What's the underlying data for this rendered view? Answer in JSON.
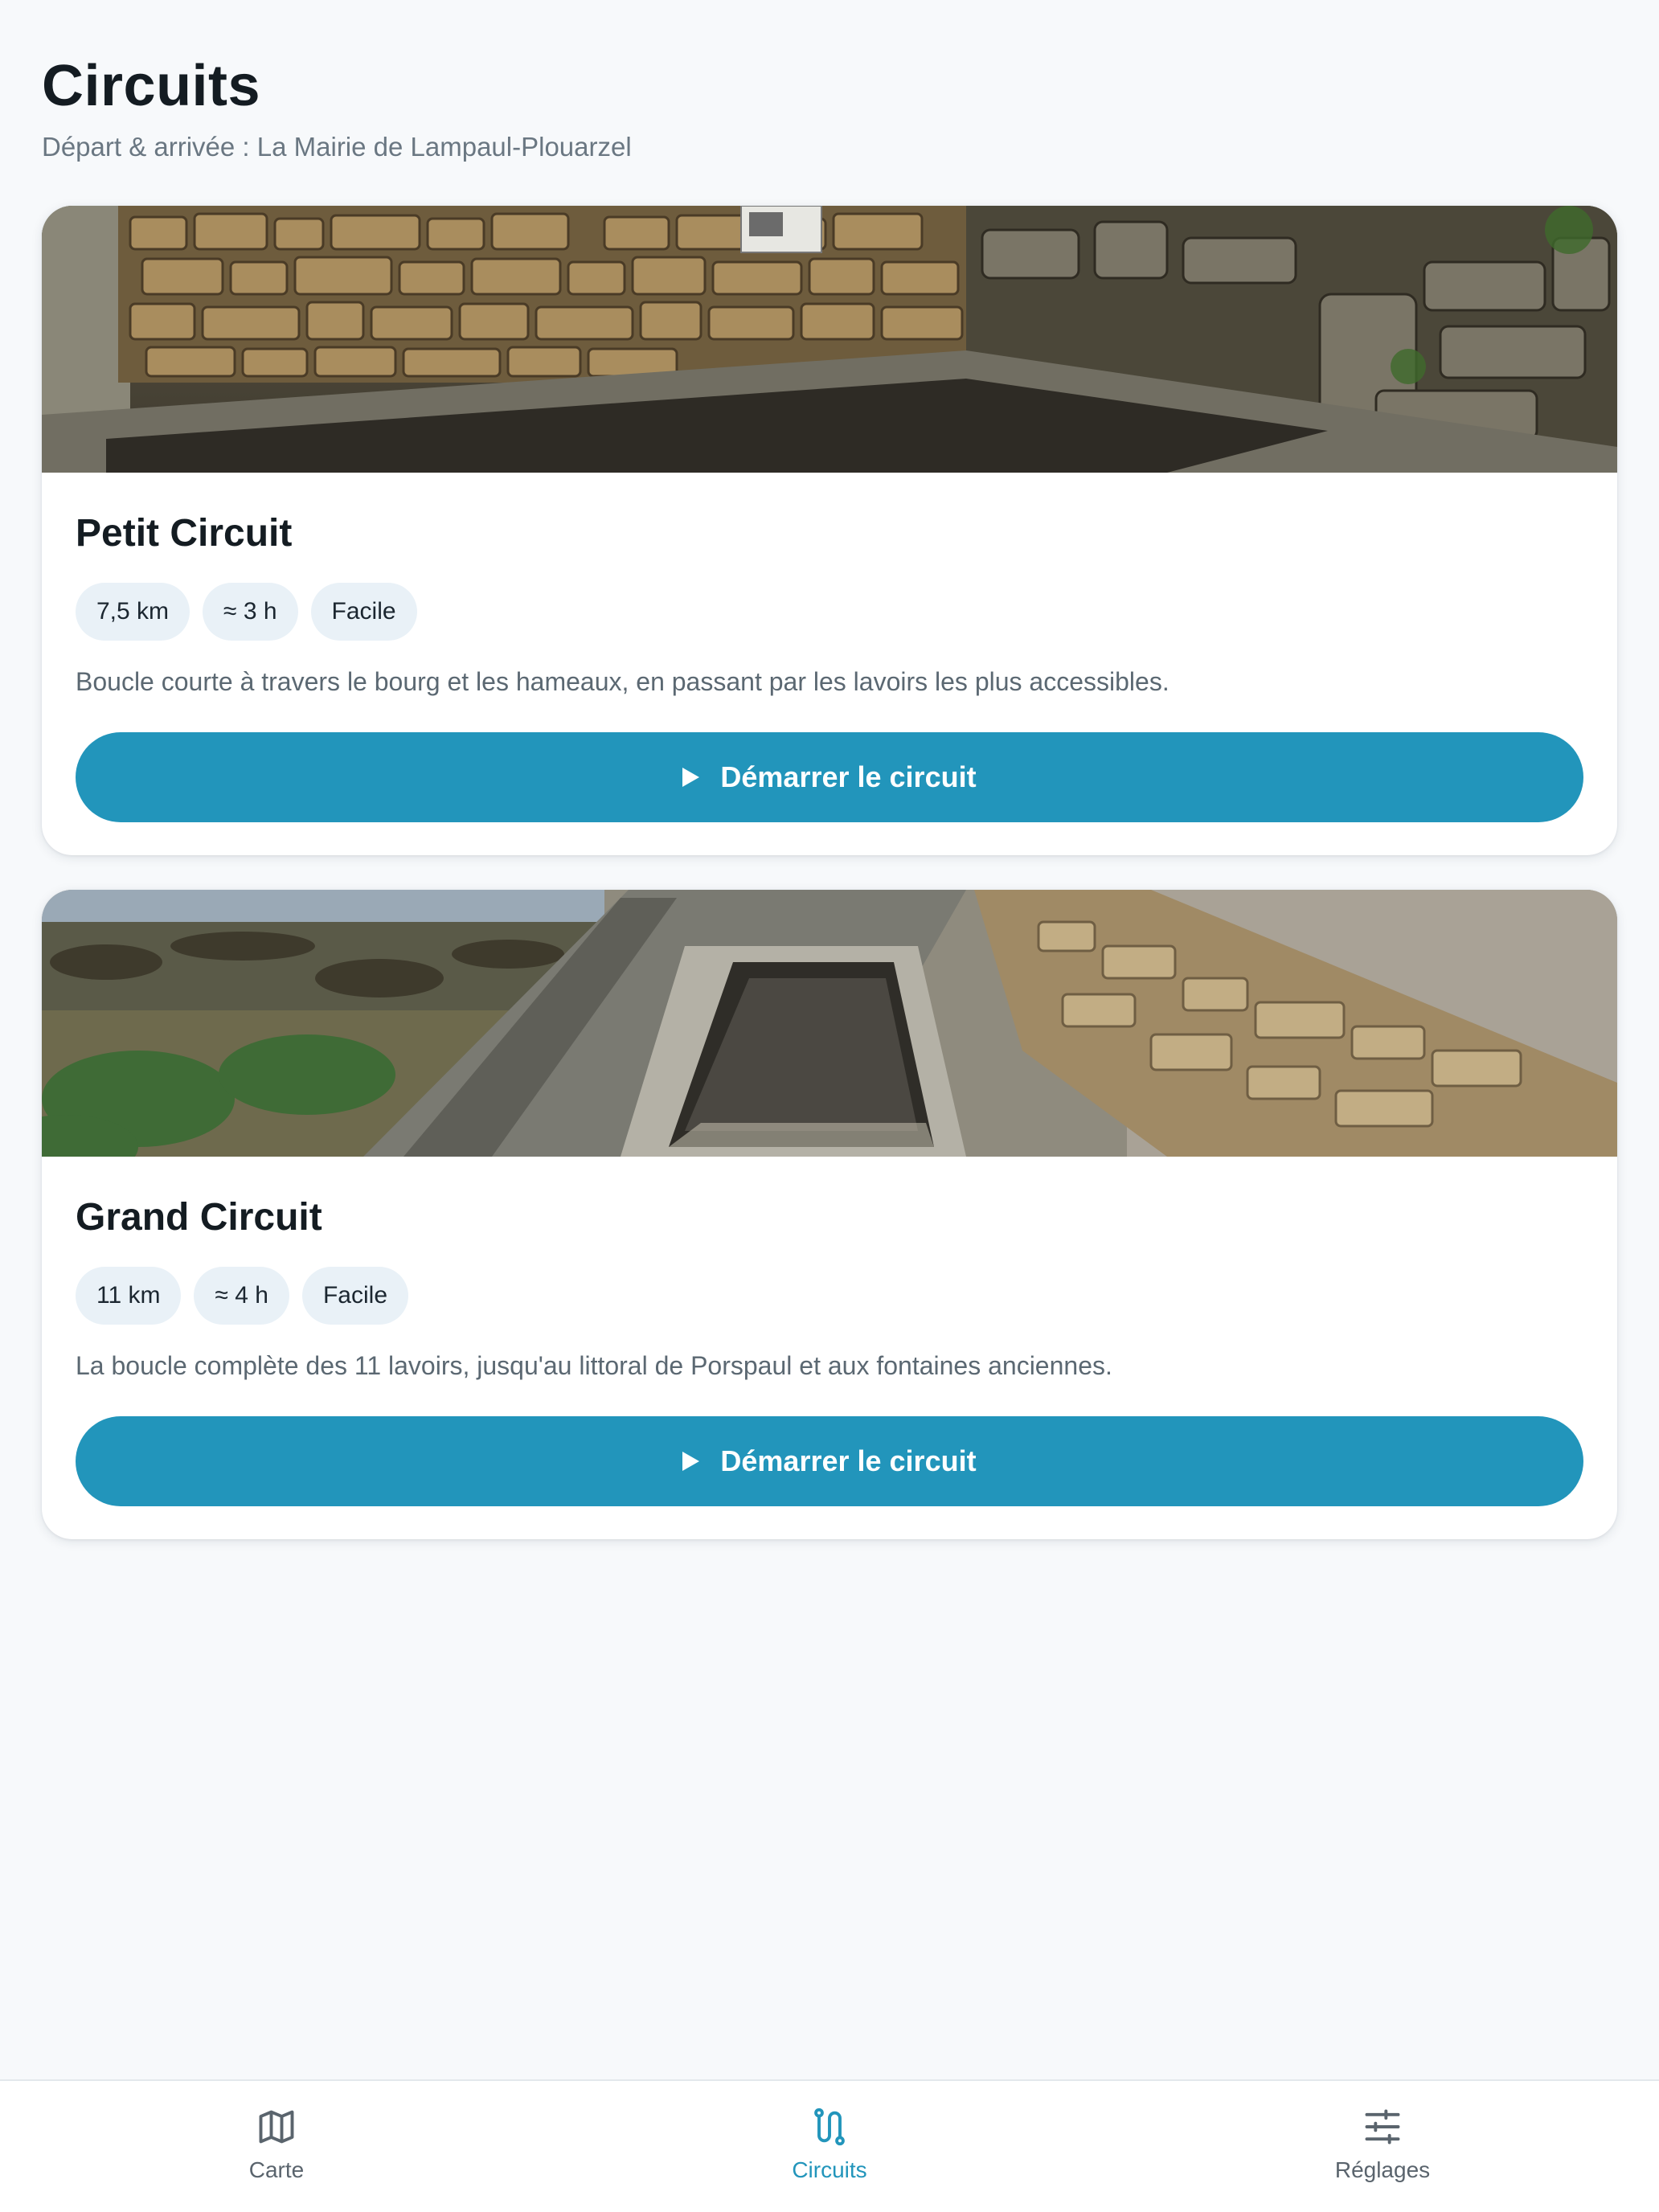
{
  "header": {
    "title": "Circuits",
    "subtitle": "Départ & arrivée : La Mairie de Lampaul-Plouarzel"
  },
  "circuits": [
    {
      "title": "Petit Circuit",
      "chips": [
        "7,5 km",
        "≈ 3 h",
        "Facile"
      ],
      "description": "Boucle courte à travers le bourg et les hameaux, en passant par les lavoirs les plus accessibles.",
      "button_label": "Démarrer le circuit",
      "image_icon": "stone-wall-photo"
    },
    {
      "title": "Grand Circuit",
      "chips": [
        "11 km",
        "≈ 4 h",
        "Facile"
      ],
      "description": "La boucle complète des 11 lavoirs, jusqu'au littoral de Porspaul et aux fontaines anciennes.",
      "button_label": "Démarrer le circuit",
      "image_icon": "coastal-washhouse-photo"
    }
  ],
  "nav": {
    "items": [
      {
        "label": "Carte",
        "icon": "map-icon",
        "active": false
      },
      {
        "label": "Circuits",
        "icon": "route-icon",
        "active": true
      },
      {
        "label": "Réglages",
        "icon": "sliders-icon",
        "active": false
      }
    ]
  },
  "colors": {
    "accent": "#2295bb",
    "background": "#f7f9fb",
    "chip": "#e9f1f7"
  }
}
